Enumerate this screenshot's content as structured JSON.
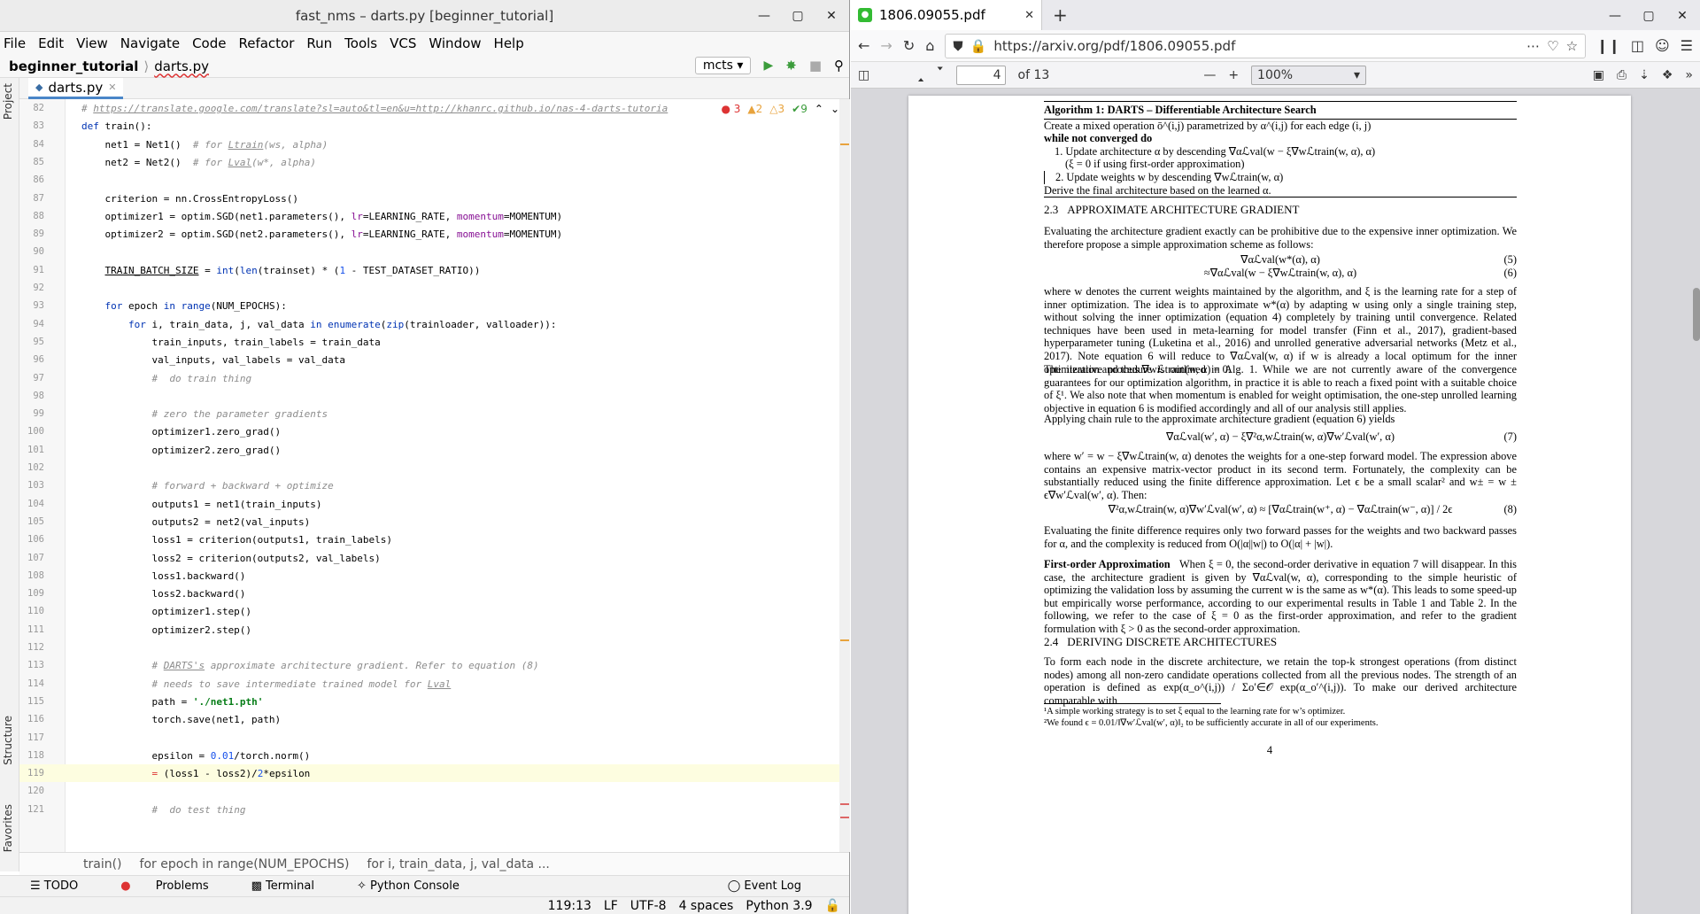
{
  "ide": {
    "title": "fast_nms – darts.py [beginner_tutorial]",
    "menu": [
      "File",
      "Edit",
      "View",
      "Navigate",
      "Code",
      "Refactor",
      "Run",
      "Tools",
      "VCS",
      "Window",
      "Help"
    ],
    "project_crumb": "beginner_tutorial",
    "file_crumb": "darts.py",
    "run_config": "mcts",
    "left_tabs": [
      "Project",
      "Structure",
      "Favorites"
    ],
    "file_tab": "darts.py",
    "inspections": {
      "errors": "3",
      "warnings": "2",
      "weak": "3",
      "ok": "9"
    },
    "code_lines": [
      {
        "n": "82",
        "html": "<span class='cm'># <u>https://translate.google.com/translate?sl=auto&tl=en&u=http://khanrc.github.io/nas-4-darts-tutoria</u></span>"
      },
      {
        "n": "83",
        "html": "<span class='kw'>def</span> train():"
      },
      {
        "n": "84",
        "html": "    net1 = Net1()  <span class='cm'># for <u>Ltrain</u>(ws, alpha)</span>"
      },
      {
        "n": "85",
        "html": "    net2 = Net2()  <span class='cm'># for <u>Lval</u>(w*, alpha)</span>"
      },
      {
        "n": "86",
        "html": ""
      },
      {
        "n": "87",
        "html": "    criterion = nn.CrossEntropyLoss()"
      },
      {
        "n": "88",
        "html": "    optimizer1 = optim.SGD(net1.parameters(), <span class='pa'>lr</span>=LEARNING_RATE, <span class='pa'>momentum</span>=MOMENTUM)"
      },
      {
        "n": "89",
        "html": "    optimizer2 = optim.SGD(net2.parameters(), <span class='pa'>lr</span>=LEARNING_RATE, <span class='pa'>momentum</span>=MOMENTUM)"
      },
      {
        "n": "90",
        "html": ""
      },
      {
        "n": "91",
        "html": "    <u>TRAIN_BATCH_SIZE</u> = <span class='kw'>int</span>(<span class='kw'>len</span>(trainset) * (<span class='nu'>1</span> - TEST_DATASET_RATIO))"
      },
      {
        "n": "92",
        "html": ""
      },
      {
        "n": "93",
        "html": "    <span class='kw'>for</span> epoch <span class='kw'>in</span> <span class='kw'>range</span>(NUM_EPOCHS):"
      },
      {
        "n": "94",
        "html": "        <span class='kw'>for</span> i, train_data, j, val_data <span class='kw'>in</span> <span class='kw'>enumerate</span>(<span class='kw'>zip</span>(trainloader, valloader)):"
      },
      {
        "n": "95",
        "html": "            train_inputs, train_labels = train_data"
      },
      {
        "n": "96",
        "html": "            val_inputs, val_labels = val_data"
      },
      {
        "n": "97",
        "html": "            <span class='cm'>#  do train thing</span>"
      },
      {
        "n": "98",
        "html": ""
      },
      {
        "n": "99",
        "html": "            <span class='cm'># zero the parameter gradients</span>"
      },
      {
        "n": "100",
        "html": "            optimizer1.zero_grad()"
      },
      {
        "n": "101",
        "html": "            optimizer2.zero_grad()"
      },
      {
        "n": "102",
        "html": ""
      },
      {
        "n": "103",
        "html": "            <span class='cm'># forward + backward + optimize</span>"
      },
      {
        "n": "104",
        "html": "            outputs1 = net1(train_inputs)"
      },
      {
        "n": "105",
        "html": "            outputs2 = net2(val_inputs)"
      },
      {
        "n": "106",
        "html": "            loss1 = criterion(outputs1, train_labels)"
      },
      {
        "n": "107",
        "html": "            loss2 = criterion(outputs2, val_labels)"
      },
      {
        "n": "108",
        "html": "            loss1.backward()"
      },
      {
        "n": "109",
        "html": "            loss2.backward()"
      },
      {
        "n": "110",
        "html": "            optimizer1.step()"
      },
      {
        "n": "111",
        "html": "            optimizer2.step()"
      },
      {
        "n": "112",
        "html": ""
      },
      {
        "n": "113",
        "html": "            <span class='cm'># <u>DARTS's</u> approximate architecture gradient. Refer to equation (8)</span>"
      },
      {
        "n": "114",
        "html": "            <span class='cm'># needs to save intermediate trained model for <u>Lval</u></span>"
      },
      {
        "n": "115",
        "html": "            path = <span class='st'>'./net1.pth'</span>"
      },
      {
        "n": "116",
        "html": "            torch.save(net1, path)"
      },
      {
        "n": "117",
        "html": ""
      },
      {
        "n": "118",
        "html": "            epsilon = <span class='nu'>0.01</span>/torch.norm()"
      },
      {
        "n": "119",
        "html": "            <span style='color:#d33'>=</span> (loss1 - loss2)/<span class='nu'>2</span>*epsilon",
        "cur": true
      },
      {
        "n": "120",
        "html": ""
      },
      {
        "n": "121",
        "html": "            <span class='cm'>#  do test thing</span>"
      }
    ],
    "breadcrumbs": [
      "train()",
      "for epoch in range(NUM_EPOCHS)",
      "for i, train_data, j, val_data ..."
    ],
    "toolwindows": [
      "TODO",
      "Problems",
      "Terminal",
      "Python Console"
    ],
    "event_log": "Event Log",
    "status": {
      "pos": "119:13",
      "sep": "LF",
      "enc": "UTF-8",
      "indent": "4 spaces",
      "interp": "Python 3.9"
    }
  },
  "firefox": {
    "tab_title": "1806.09055.pdf",
    "url": "https://arxiv.org/pdf/1806.09055.pdf",
    "page_current": "4",
    "page_total": "of 13",
    "zoom": "100%"
  },
  "paper": {
    "algo_title": "Algorithm 1: DARTS – Differentiable Architecture Search",
    "algo_lines": [
      "Create a mixed operation ō^(i,j) parametrized by α^(i,j) for each edge (i, j)",
      "while not converged do",
      "1. Update architecture α by descending ∇αℒval(w − ξ∇wℒtrain(w, α), α)",
      "(ξ = 0 if using first-order approximation)",
      "2. Update weights w by descending ∇wℒtrain(w, α)",
      "Derive the final architecture based on the learned α."
    ],
    "sec23_num": "2.3",
    "sec23_title": "APPROXIMATE ARCHITECTURE GRADIENT",
    "p1": "Evaluating the architecture gradient exactly can be prohibitive due to the expensive inner optimization. We therefore propose a simple approximation scheme as follows:",
    "eq5": "∇αℒval(w*(α), α)",
    "eq5n": "(5)",
    "eq6": "≈∇αℒval(w − ξ∇wℒtrain(w, α), α)",
    "eq6n": "(6)",
    "p2": "where w denotes the current weights maintained by the algorithm, and ξ is the learning rate for a step of inner optimization. The idea is to approximate w*(α) by adapting w using only a single training step, without solving the inner optimization (equation 4) completely by training until convergence. Related techniques have been used in meta-learning for model transfer (Finn et al., 2017), gradient-based hyperparameter tuning (Luketina et al., 2016) and unrolled generative adversarial networks (Metz et al., 2017). Note equation 6 will reduce to ∇αℒval(w, α) if w is already a local optimum for the inner optimization and thus ∇wℒtrain(w, α) = 0.",
    "p3": "The iterative procedure is outlined in Alg. 1. While we are not currently aware of the convergence guarantees for our optimization algorithm, in practice it is able to reach a fixed point with a suitable choice of ξ¹. We also note that when momentum is enabled for weight optimisation, the one-step unrolled learning objective in equation 6 is modified accordingly and all of our analysis still applies.",
    "p4": "Applying chain rule to the approximate architecture gradient (equation 6) yields",
    "eq7": "∇αℒval(w′, α) − ξ∇²α,wℒtrain(w, α)∇w′ℒval(w′, α)",
    "eq7n": "(7)",
    "p5": "where w′ = w − ξ∇wℒtrain(w, α) denotes the weights for a one-step forward model. The expression above contains an expensive matrix-vector product in its second term. Fortunately, the complexity can be substantially reduced using the finite difference approximation. Let ϵ be a small scalar² and w± = w ± ϵ∇w′ℒval(w′, α). Then:",
    "eq8": "∇²α,wℒtrain(w, α)∇w′ℒval(w′, α) ≈ [∇αℒtrain(w⁺, α) − ∇αℒtrain(w⁻, α)] / 2ϵ",
    "eq8n": "(8)",
    "p6": "Evaluating the finite difference requires only two forward passes for the weights and two backward passes for α, and the complexity is reduced from O(|α||w|) to O(|α| + |w|).",
    "p7_head": "First-order Approximation",
    "p7": "When ξ = 0, the second-order derivative in equation 7 will disappear. In this case, the architecture gradient is given by ∇αℒval(w, α), corresponding to the simple heuristic of optimizing the validation loss by assuming the current w is the same as w*(α). This leads to some speed-up but empirically worse performance, according to our experimental results in Table 1 and Table 2. In the following, we refer to the case of ξ = 0 as the first-order approximation, and refer to the gradient formulation with ξ > 0 as the second-order approximation.",
    "sec24_num": "2.4",
    "sec24_title": "DERIVING DISCRETE ARCHITECTURES",
    "p8": "To form each node in the discrete architecture, we retain the top-k strongest operations (from distinct nodes) among all non-zero candidate operations collected from all the previous nodes. The strength of an operation is defined as exp(α_o^(i,j)) / Σo′∈𝒪 exp(α_o′^(i,j)). To make our derived architecture comparable with",
    "fn1": "¹A simple working strategy is to set ξ equal to the learning rate for w’s optimizer.",
    "fn2": "²We found ϵ = 0.01/‖∇w′ℒval(w′, α)‖₂ to be sufficiently accurate in all of our experiments.",
    "page_number": "4"
  }
}
